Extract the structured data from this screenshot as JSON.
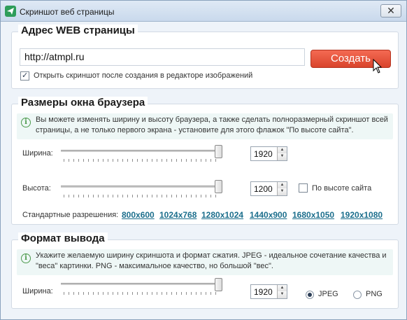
{
  "window": {
    "title": "Скриншот веб страницы",
    "close_glyph": "✕"
  },
  "address_section": {
    "title": "Адрес WEB страницы",
    "url_value": "http://atmpl.ru",
    "create_button": "Создать",
    "open_in_editor_checked": true,
    "open_in_editor_label": "Открыть скриншот после создания в редакторе изображений"
  },
  "browser_section": {
    "title": "Размеры окна браузера",
    "info": "Вы можете изменять ширину и высоту браузера, а также сделать полноразмерный скриншот всей страницы, а не только первого экрана - установите для этого флажок \"По высоте сайта\".",
    "width_label": "Ширина:",
    "width_value": "1920",
    "height_label": "Высота:",
    "height_value": "1200",
    "fit_height_checked": false,
    "fit_height_label": "По высоте сайта",
    "presets_label": "Стандартные разрешения:",
    "presets": [
      "800x600",
      "1024x768",
      "1280x1024",
      "1440x900",
      "1680x1050",
      "1920x1080"
    ]
  },
  "output_section": {
    "title": "Формат вывода",
    "info": "Укажите желаемую ширину скриншота и формат сжатия. JPEG - идеальное сочетание качества и \"веса\" картинки. PNG - максимальное качество, но большой \"вес\".",
    "width_label": "Ширина:",
    "width_value": "1920",
    "format_jpeg_label": "JPEG",
    "format_png_label": "PNG",
    "selected_format": "JPEG"
  },
  "colors": {
    "accent_button": "#e0503a",
    "link": "#1b6e8c",
    "info_bg": "#eef7f6"
  }
}
